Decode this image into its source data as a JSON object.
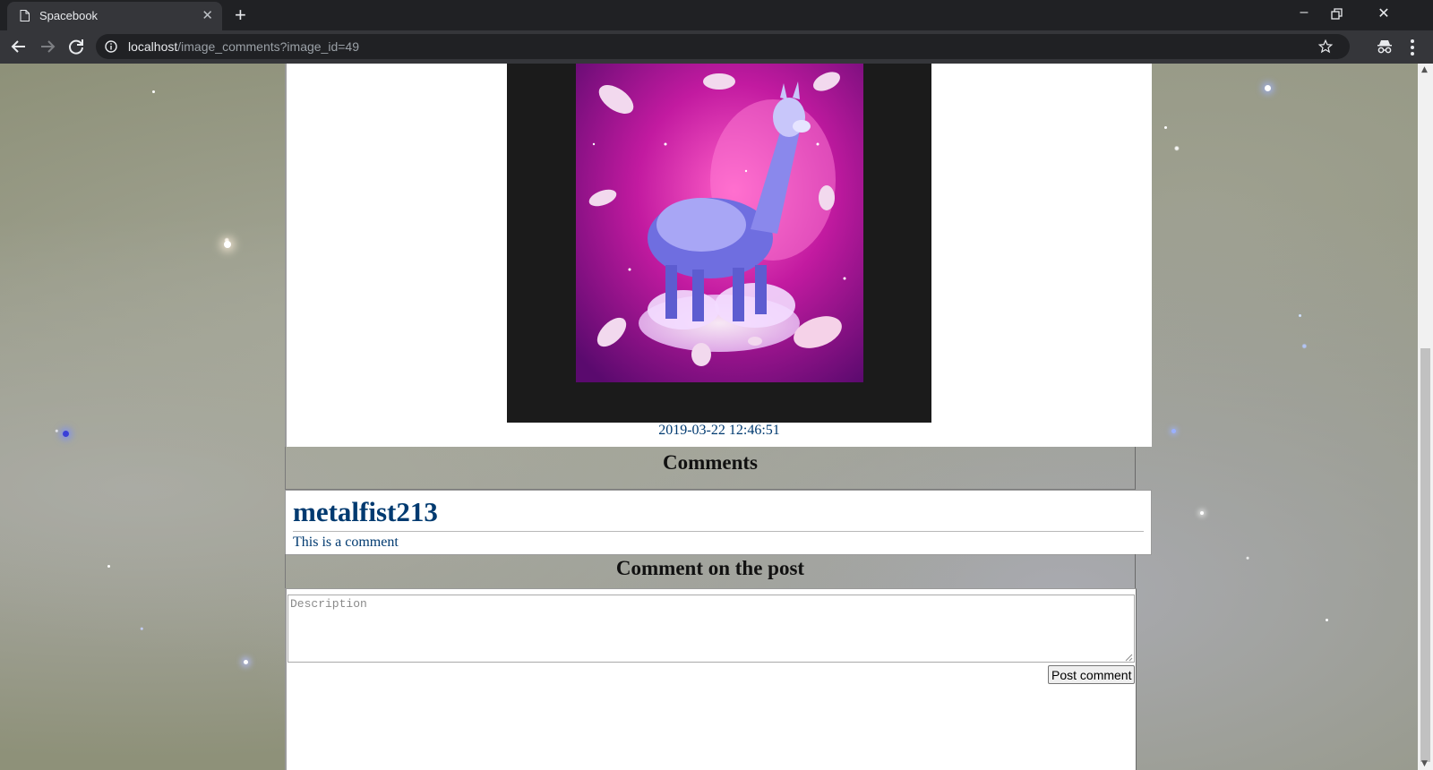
{
  "browser": {
    "tab_title": "Spacebook",
    "url_host": "localhost",
    "url_path": "/image_comments?image_id=49"
  },
  "post": {
    "date": "2019-03-22 12:46:51"
  },
  "comments_section": {
    "heading": "Comments",
    "comments": [
      {
        "author": "metalfist213",
        "text": "This is a comment"
      }
    ]
  },
  "comment_form": {
    "heading": "Comment on the post",
    "placeholder": "Description",
    "submit_label": "Post comment"
  },
  "icons": {
    "tab_page": "page-icon",
    "tab_close": "close-icon",
    "new_tab": "plus-icon",
    "back": "arrow-left-icon",
    "forward": "arrow-right-icon",
    "reload": "reload-icon",
    "site_info": "info-icon",
    "bookmark": "star-icon",
    "incognito": "incognito-icon",
    "menu": "kebab-menu-icon"
  },
  "colors": {
    "link_text": "#003a70",
    "chrome_dark": "#202124",
    "chrome_toolbar": "#35363a"
  }
}
